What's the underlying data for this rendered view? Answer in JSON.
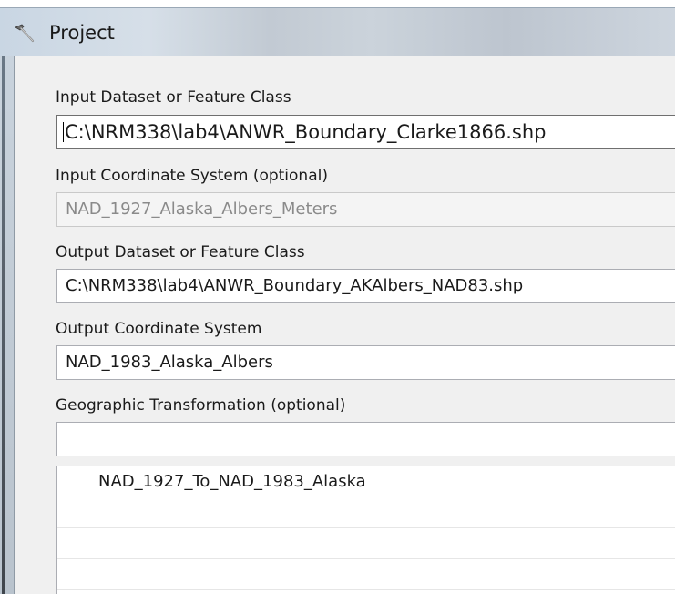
{
  "window": {
    "title": "Project",
    "icon": "hammer-icon"
  },
  "fields": {
    "input_dataset": {
      "label": "Input Dataset or Feature Class",
      "value": "C:\\NRM338\\lab4\\ANWR_Boundary_Clarke1866.shp"
    },
    "input_coordinate_system": {
      "label": "Input Coordinate System (optional)",
      "value": "NAD_1927_Alaska_Albers_Meters",
      "enabled": false
    },
    "output_dataset": {
      "label": "Output Dataset or Feature Class",
      "value": "C:\\NRM338\\lab4\\ANWR_Boundary_AKAlbers_NAD83.shp"
    },
    "output_coordinate_system": {
      "label": "Output Coordinate System",
      "value": "NAD_1983_Alaska_Albers"
    },
    "geographic_transformation": {
      "label": "Geographic Transformation (optional)",
      "value": ""
    }
  },
  "transformation_list": {
    "items": [
      "NAD_1927_To_NAD_1983_Alaska",
      "",
      "",
      ""
    ]
  },
  "colors": {
    "panel_background": "#f0f0f0",
    "field_border": "#abadb3",
    "disabled_text": "#8a8a8a"
  }
}
